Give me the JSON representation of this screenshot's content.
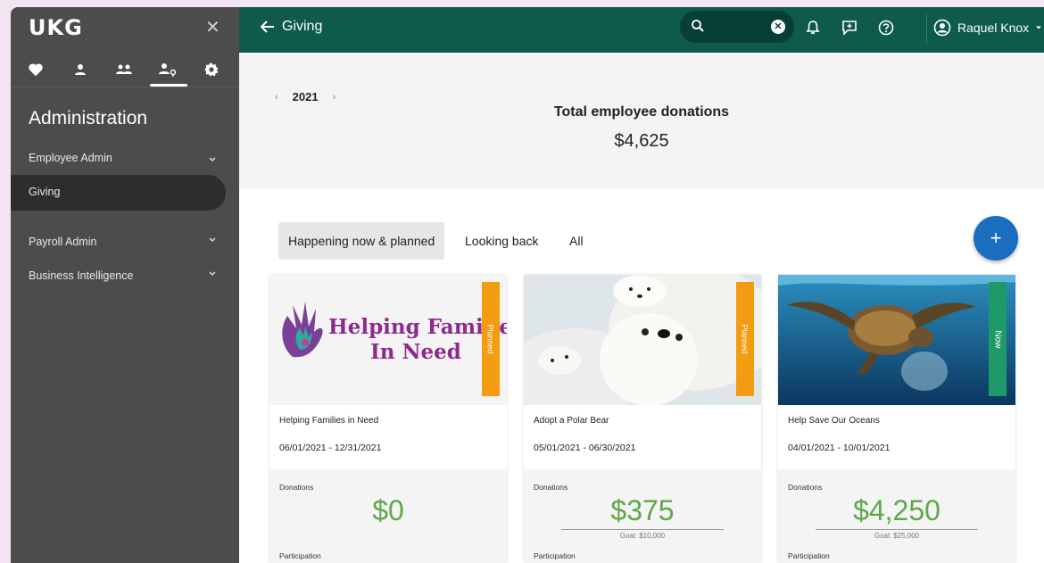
{
  "sidebar": {
    "logo": "UKG",
    "close": "✕",
    "title": "Administration",
    "items": [
      {
        "label": "Employee Admin"
      },
      {
        "label": "Giving"
      },
      {
        "label": "Payroll Admin"
      },
      {
        "label": "Business Intelligence"
      }
    ]
  },
  "header": {
    "back_title": "Giving",
    "user_name": "Raquel Knox",
    "search_clear": "✕"
  },
  "summary": {
    "year": "2021",
    "total_label": "Total employee donations",
    "total_value": "$4,625"
  },
  "tabs": [
    {
      "label": "Happening now & planned"
    },
    {
      "label": "Looking back"
    },
    {
      "label": "All"
    }
  ],
  "fab": "+",
  "cards": [
    {
      "name": "Helping Families in Need",
      "dates": "06/01/2021 - 12/31/2021",
      "badge": "Planned",
      "badge_color": "#f39c12",
      "image_text_1": "Helping Familie",
      "image_text_2": "In Need",
      "donations_label": "Donations",
      "amount": "$0",
      "goal": "",
      "participation_label": "Participation"
    },
    {
      "name": "Adopt a Polar Bear",
      "dates": "05/01/2021 - 06/30/2021",
      "badge": "Planned",
      "badge_color": "#f39c12",
      "donations_label": "Donations",
      "amount": "$375",
      "goal": "Goal: $10,000",
      "participation_label": "Participation"
    },
    {
      "name": "Help Save Our Oceans",
      "dates": "04/01/2021 - 10/01/2021",
      "badge": "Now",
      "badge_color": "#1e9a6a",
      "donations_label": "Donations",
      "amount": "$4,250",
      "goal": "Goal: $25,000",
      "participation_label": "Participation"
    }
  ],
  "colors": {
    "header": "#0e5a4c",
    "sidebar": "#4c4c4c",
    "accent": "#1b6dbf",
    "amount": "#5ea84a"
  }
}
